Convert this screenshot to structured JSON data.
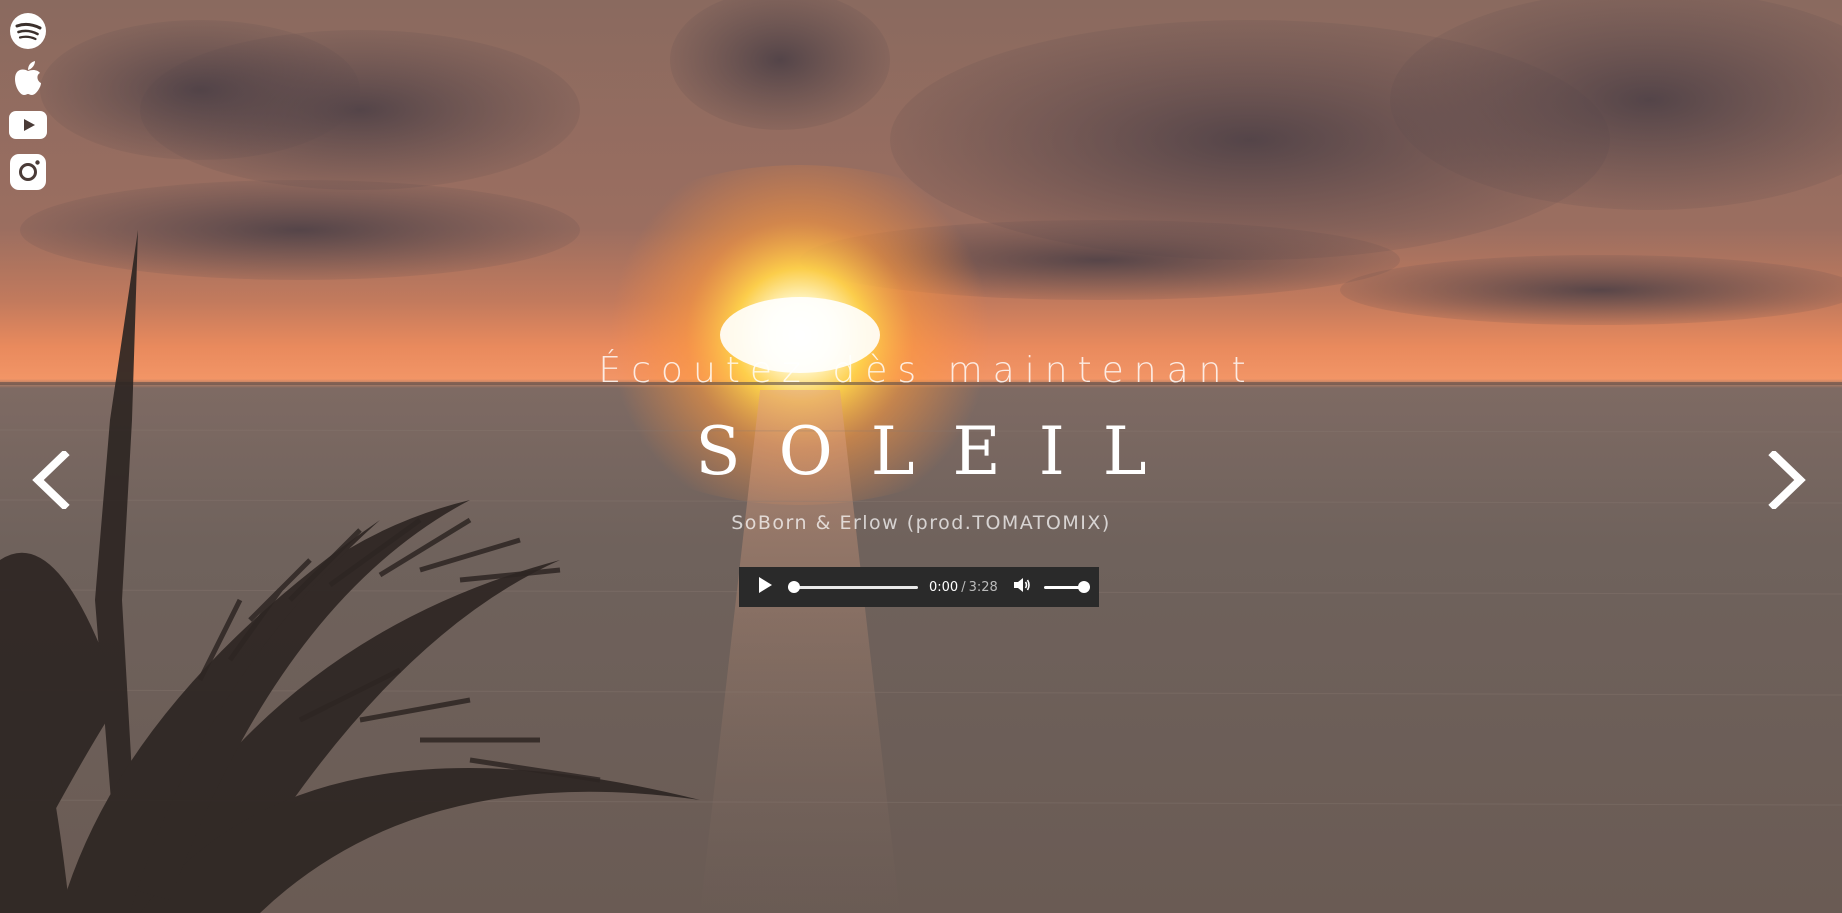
{
  "hero": {
    "kicker": "Écoutez dès maintenant",
    "title": "SOLEIL",
    "artists": "SoBorn & Erlow (prod.TOMATOMIX)"
  },
  "player": {
    "current_time": "0:00",
    "separator": "/",
    "total_time": "3:28",
    "progress": 0,
    "volume": 1
  },
  "social": [
    {
      "name": "spotify",
      "icon": "spotify-icon"
    },
    {
      "name": "apple-music",
      "icon": "apple-icon"
    },
    {
      "name": "youtube",
      "icon": "youtube-icon"
    },
    {
      "name": "instagram",
      "icon": "instagram-icon"
    }
  ],
  "navigation": {
    "prev_icon": "chevron-left-icon",
    "next_icon": "chevron-right-icon"
  },
  "colors": {
    "sky_top": "#8f6a5c",
    "sun_glow": "#ffd24a",
    "horizon": "#f08a55",
    "sea": "#6e605a",
    "player_bg": "#2a2a2a",
    "text": "#ffffff"
  }
}
